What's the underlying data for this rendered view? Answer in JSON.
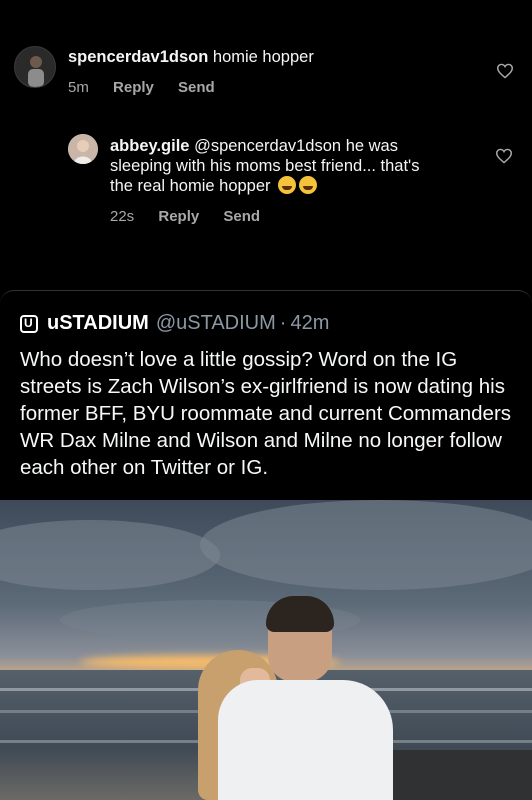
{
  "comments": [
    {
      "username": "spencerdav1dson",
      "text": "homie hopper",
      "time": "5m",
      "reply_label": "Reply",
      "send_label": "Send"
    },
    {
      "username": "abbey.gile",
      "mention": "@spencerdav1dson",
      "text": "he was sleeping with his moms best friend... that's the real homie hopper",
      "time": "22s",
      "reply_label": "Reply",
      "send_label": "Send"
    }
  ],
  "tweet": {
    "author_name": "uSTADIUM",
    "handle": "@uSTADIUM",
    "separator": "·",
    "time": "42m",
    "text": "Who doesn’t love a little gossip? Word on the IG streets is Zach Wilson’s ex-girlfriend is now dating his former BFF, BYU roommate and current Commanders WR Dax Milne and Wilson and Milne no longer follow each other on Twitter or IG."
  },
  "icons": [
    "heart-icon",
    "avatar",
    "laughing-emoji",
    "ustadium-logo"
  ],
  "colors": {
    "background": "#000000",
    "muted_text": "#a8a8a8",
    "tweet_meta": "#8b98a5"
  }
}
